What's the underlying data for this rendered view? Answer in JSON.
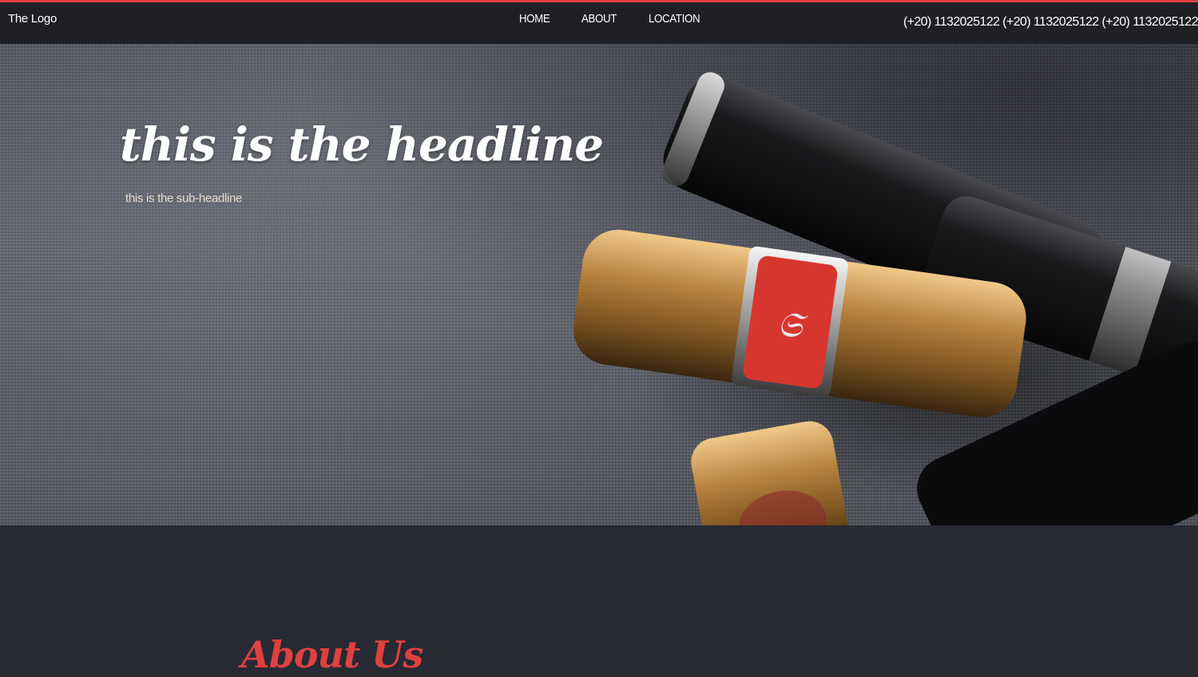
{
  "colors": {
    "accent": "#e0413f",
    "navbar_bg": "#1f2026",
    "page_bg": "#272a33"
  },
  "header": {
    "logo": "The Logo",
    "nav": [
      "HOME",
      "ABOUT",
      "LOCATION"
    ],
    "phones": "(+20) 1132025122 (+20) 1132025122 (+20) 1132025122"
  },
  "hero": {
    "headline": "this is the headline",
    "subheadline": "this is the sub-headline",
    "image": "lipsticks-photo"
  },
  "about": {
    "title": "About Us"
  }
}
